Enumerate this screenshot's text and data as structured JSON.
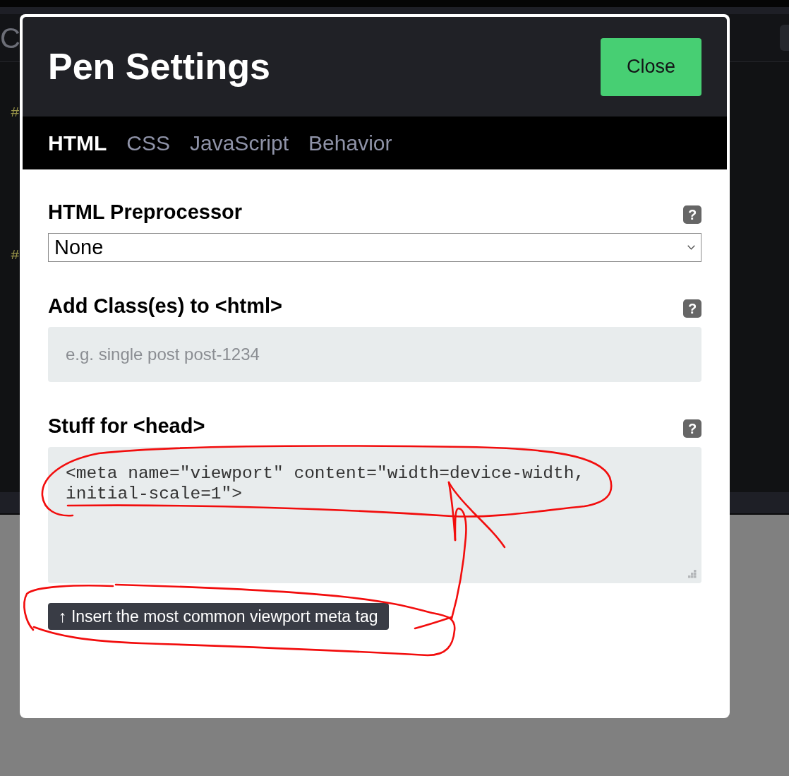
{
  "background": {
    "editor_title": "C",
    "code_marks": [
      {
        "text": "#"
      },
      {
        "text": "#"
      }
    ]
  },
  "dialog": {
    "title": "Pen Settings",
    "close_button": "Close",
    "tabs": [
      {
        "label": "HTML",
        "selected": true
      },
      {
        "label": "CSS",
        "selected": false
      },
      {
        "label": "JavaScript",
        "selected": false
      },
      {
        "label": "Behavior",
        "selected": false
      }
    ],
    "fields": [
      {
        "kind": "select",
        "label": "HTML Preprocessor",
        "help": "?",
        "value": "None"
      },
      {
        "kind": "input",
        "label": "Add Class(es) to <html>",
        "help": "?",
        "placeholder": "e.g. single post post-1234"
      },
      {
        "kind": "textarea",
        "label": "Stuff for <head>",
        "help": "?",
        "value": "<meta name=\"viewport\" content=\"width=device-width, initial-scale=1\">"
      }
    ],
    "insert_button": "↑ Insert the most common viewport meta tag"
  },
  "pen_marks": [
    {
      "kind": "loop"
    },
    {
      "kind": "loop"
    },
    {
      "kind": "arrow"
    }
  ]
}
